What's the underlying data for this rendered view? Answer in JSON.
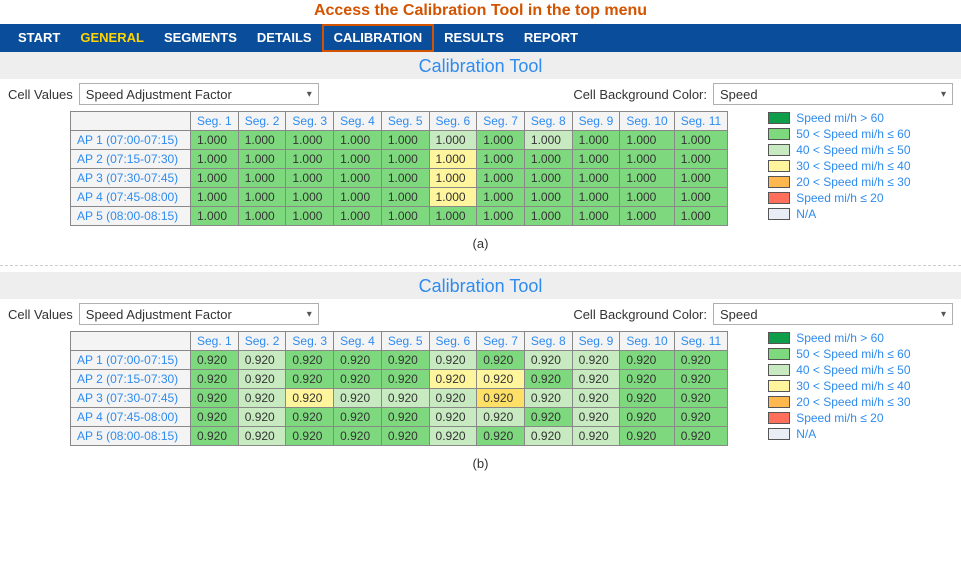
{
  "callout_text": "Access the Calibration Tool in the top menu",
  "topbar": {
    "tabs": [
      "START",
      "GENERAL",
      "SEGMENTS",
      "DETAILS",
      "CALIBRATION",
      "RESULTS",
      "REPORT"
    ]
  },
  "panel_title": "Calibration Tool",
  "controls": {
    "cell_values_label": "Cell Values",
    "cell_values_selected": "Speed Adjustment Factor",
    "bg_color_label": "Cell Background Color:",
    "bg_color_selected": "Speed"
  },
  "legend": [
    {
      "swatch": "sw-g0",
      "text": "Speed mi/h > 60"
    },
    {
      "swatch": "sw-g1",
      "text": "50 < Speed mi/h ≤ 60"
    },
    {
      "swatch": "sw-g2",
      "text": "40 < Speed mi/h ≤ 50"
    },
    {
      "swatch": "sw-y1",
      "text": "30 < Speed mi/h ≤ 40"
    },
    {
      "swatch": "sw-o1",
      "text": "20 < Speed mi/h ≤ 30"
    },
    {
      "swatch": "sw-r1",
      "text": "Speed mi/h ≤ 20"
    },
    {
      "swatch": "sw-na",
      "text": "N/A"
    }
  ],
  "grids": [
    {
      "caption": "(a)",
      "col_headers": [
        "Seg. 1",
        "Seg. 2",
        "Seg. 3",
        "Seg. 4",
        "Seg. 5",
        "Seg. 6",
        "Seg. 7",
        "Seg. 8",
        "Seg. 9",
        "Seg. 10",
        "Seg. 11"
      ],
      "rows": [
        {
          "label": "AP 1 (07:00-07:15)",
          "cells": [
            {
              "v": "1.000",
              "c": "c-g1"
            },
            {
              "v": "1.000",
              "c": "c-g1"
            },
            {
              "v": "1.000",
              "c": "c-g1"
            },
            {
              "v": "1.000",
              "c": "c-g1"
            },
            {
              "v": "1.000",
              "c": "c-g1"
            },
            {
              "v": "1.000",
              "c": "c-g2"
            },
            {
              "v": "1.000",
              "c": "c-g1"
            },
            {
              "v": "1.000",
              "c": "c-g2"
            },
            {
              "v": "1.000",
              "c": "c-g1"
            },
            {
              "v": "1.000",
              "c": "c-g1"
            },
            {
              "v": "1.000",
              "c": "c-g1"
            }
          ]
        },
        {
          "label": "AP 2 (07:15-07:30)",
          "cells": [
            {
              "v": "1.000",
              "c": "c-g1"
            },
            {
              "v": "1.000",
              "c": "c-g1"
            },
            {
              "v": "1.000",
              "c": "c-g1"
            },
            {
              "v": "1.000",
              "c": "c-g1"
            },
            {
              "v": "1.000",
              "c": "c-g1"
            },
            {
              "v": "1.000",
              "c": "c-y1"
            },
            {
              "v": "1.000",
              "c": "c-g1"
            },
            {
              "v": "1.000",
              "c": "c-g1"
            },
            {
              "v": "1.000",
              "c": "c-g1"
            },
            {
              "v": "1.000",
              "c": "c-g1"
            },
            {
              "v": "1.000",
              "c": "c-g1"
            }
          ]
        },
        {
          "label": "AP 3 (07:30-07:45)",
          "cells": [
            {
              "v": "1.000",
              "c": "c-g1"
            },
            {
              "v": "1.000",
              "c": "c-g1"
            },
            {
              "v": "1.000",
              "c": "c-g1"
            },
            {
              "v": "1.000",
              "c": "c-g1"
            },
            {
              "v": "1.000",
              "c": "c-g1"
            },
            {
              "v": "1.000",
              "c": "c-y1"
            },
            {
              "v": "1.000",
              "c": "c-g1"
            },
            {
              "v": "1.000",
              "c": "c-g1"
            },
            {
              "v": "1.000",
              "c": "c-g1"
            },
            {
              "v": "1.000",
              "c": "c-g1"
            },
            {
              "v": "1.000",
              "c": "c-g1"
            }
          ]
        },
        {
          "label": "AP 4 (07:45-08:00)",
          "cells": [
            {
              "v": "1.000",
              "c": "c-g1"
            },
            {
              "v": "1.000",
              "c": "c-g1"
            },
            {
              "v": "1.000",
              "c": "c-g1"
            },
            {
              "v": "1.000",
              "c": "c-g1"
            },
            {
              "v": "1.000",
              "c": "c-g1"
            },
            {
              "v": "1.000",
              "c": "c-y1"
            },
            {
              "v": "1.000",
              "c": "c-g1"
            },
            {
              "v": "1.000",
              "c": "c-g1"
            },
            {
              "v": "1.000",
              "c": "c-g1"
            },
            {
              "v": "1.000",
              "c": "c-g1"
            },
            {
              "v": "1.000",
              "c": "c-g1"
            }
          ]
        },
        {
          "label": "AP 5 (08:00-08:15)",
          "cells": [
            {
              "v": "1.000",
              "c": "c-g1"
            },
            {
              "v": "1.000",
              "c": "c-g1"
            },
            {
              "v": "1.000",
              "c": "c-g1"
            },
            {
              "v": "1.000",
              "c": "c-g1"
            },
            {
              "v": "1.000",
              "c": "c-g1"
            },
            {
              "v": "1.000",
              "c": "c-g1"
            },
            {
              "v": "1.000",
              "c": "c-g1"
            },
            {
              "v": "1.000",
              "c": "c-g1"
            },
            {
              "v": "1.000",
              "c": "c-g1"
            },
            {
              "v": "1.000",
              "c": "c-g1"
            },
            {
              "v": "1.000",
              "c": "c-g1"
            }
          ]
        }
      ]
    },
    {
      "caption": "(b)",
      "col_headers": [
        "Seg. 1",
        "Seg. 2",
        "Seg. 3",
        "Seg. 4",
        "Seg. 5",
        "Seg. 6",
        "Seg. 7",
        "Seg. 8",
        "Seg. 9",
        "Seg. 10",
        "Seg. 11"
      ],
      "rows": [
        {
          "label": "AP 1 (07:00-07:15)",
          "cells": [
            {
              "v": "0.920",
              "c": "c-g1"
            },
            {
              "v": "0.920",
              "c": "c-g2"
            },
            {
              "v": "0.920",
              "c": "c-g1"
            },
            {
              "v": "0.920",
              "c": "c-g1"
            },
            {
              "v": "0.920",
              "c": "c-g1"
            },
            {
              "v": "0.920",
              "c": "c-g2"
            },
            {
              "v": "0.920",
              "c": "c-g1"
            },
            {
              "v": "0.920",
              "c": "c-g2"
            },
            {
              "v": "0.920",
              "c": "c-g2"
            },
            {
              "v": "0.920",
              "c": "c-g1"
            },
            {
              "v": "0.920",
              "c": "c-g1"
            }
          ]
        },
        {
          "label": "AP 2 (07:15-07:30)",
          "cells": [
            {
              "v": "0.920",
              "c": "c-g1"
            },
            {
              "v": "0.920",
              "c": "c-g2"
            },
            {
              "v": "0.920",
              "c": "c-g1"
            },
            {
              "v": "0.920",
              "c": "c-g1"
            },
            {
              "v": "0.920",
              "c": "c-g1"
            },
            {
              "v": "0.920",
              "c": "c-y1"
            },
            {
              "v": "0.920",
              "c": "c-y1"
            },
            {
              "v": "0.920",
              "c": "c-g1"
            },
            {
              "v": "0.920",
              "c": "c-g2"
            },
            {
              "v": "0.920",
              "c": "c-g1"
            },
            {
              "v": "0.920",
              "c": "c-g1"
            }
          ]
        },
        {
          "label": "AP 3 (07:30-07:45)",
          "cells": [
            {
              "v": "0.920",
              "c": "c-g1"
            },
            {
              "v": "0.920",
              "c": "c-g2"
            },
            {
              "v": "0.920",
              "c": "c-y1"
            },
            {
              "v": "0.920",
              "c": "c-g2"
            },
            {
              "v": "0.920",
              "c": "c-g2"
            },
            {
              "v": "0.920",
              "c": "c-g2"
            },
            {
              "v": "0.920",
              "c": "c-y2"
            },
            {
              "v": "0.920",
              "c": "c-g2"
            },
            {
              "v": "0.920",
              "c": "c-g2"
            },
            {
              "v": "0.920",
              "c": "c-g1"
            },
            {
              "v": "0.920",
              "c": "c-g1"
            }
          ]
        },
        {
          "label": "AP 4 (07:45-08:00)",
          "cells": [
            {
              "v": "0.920",
              "c": "c-g1"
            },
            {
              "v": "0.920",
              "c": "c-g2"
            },
            {
              "v": "0.920",
              "c": "c-g1"
            },
            {
              "v": "0.920",
              "c": "c-g1"
            },
            {
              "v": "0.920",
              "c": "c-g1"
            },
            {
              "v": "0.920",
              "c": "c-g2"
            },
            {
              "v": "0.920",
              "c": "c-g2"
            },
            {
              "v": "0.920",
              "c": "c-g1"
            },
            {
              "v": "0.920",
              "c": "c-g2"
            },
            {
              "v": "0.920",
              "c": "c-g1"
            },
            {
              "v": "0.920",
              "c": "c-g1"
            }
          ]
        },
        {
          "label": "AP 5 (08:00-08:15)",
          "cells": [
            {
              "v": "0.920",
              "c": "c-g1"
            },
            {
              "v": "0.920",
              "c": "c-g2"
            },
            {
              "v": "0.920",
              "c": "c-g1"
            },
            {
              "v": "0.920",
              "c": "c-g1"
            },
            {
              "v": "0.920",
              "c": "c-g1"
            },
            {
              "v": "0.920",
              "c": "c-g2"
            },
            {
              "v": "0.920",
              "c": "c-g1"
            },
            {
              "v": "0.920",
              "c": "c-g2"
            },
            {
              "v": "0.920",
              "c": "c-g2"
            },
            {
              "v": "0.920",
              "c": "c-g1"
            },
            {
              "v": "0.920",
              "c": "c-g1"
            }
          ]
        }
      ]
    }
  ]
}
